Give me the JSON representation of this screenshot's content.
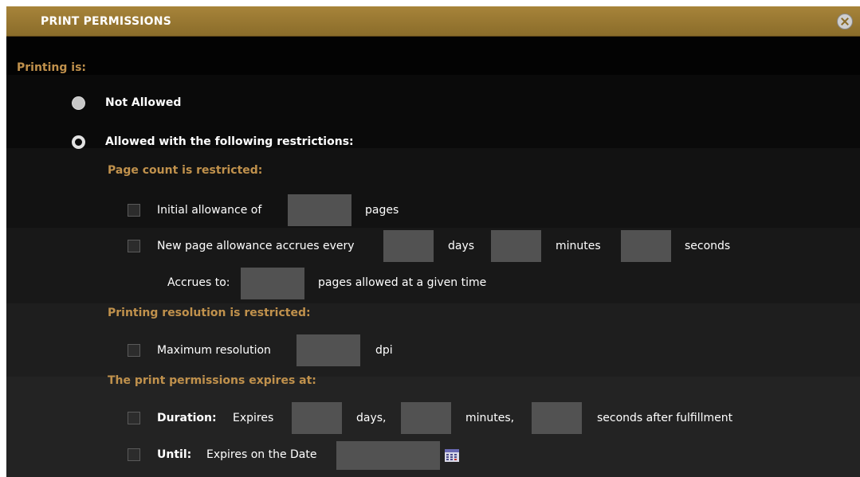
{
  "dialog": {
    "title": "PRINT PERMISSIONS",
    "close_icon": "close-icon"
  },
  "printing": {
    "label": "Printing is:",
    "not_allowed": "Not Allowed",
    "allowed": "Allowed with the following restrictions:",
    "selected": "allowed"
  },
  "page_count": {
    "heading": "Page count is restricted:",
    "initial_label": "Initial allowance of",
    "initial_unit": "pages",
    "accrue_label": "New page allowance accrues every",
    "days": "days",
    "minutes": "minutes",
    "seconds": "seconds",
    "accrues_to_label": "Accrues to:",
    "accrues_to_unit": "pages allowed at a given time"
  },
  "resolution": {
    "heading": "Printing resolution is restricted:",
    "max_label": "Maximum resolution",
    "unit": "dpi"
  },
  "expiry": {
    "heading": "The print permissions expires at:",
    "duration_label": "Duration:",
    "expires": "Expires",
    "days": "days,",
    "minutes": "minutes,",
    "seconds_after": "seconds after fulfillment",
    "until_label": "Until:",
    "expires_on_date": "Expires on the Date",
    "calendar_icon": "calendar-icon"
  },
  "colors": {
    "accent": "#c0914c",
    "titlebar": "#9a7a33",
    "field": "#525252"
  }
}
